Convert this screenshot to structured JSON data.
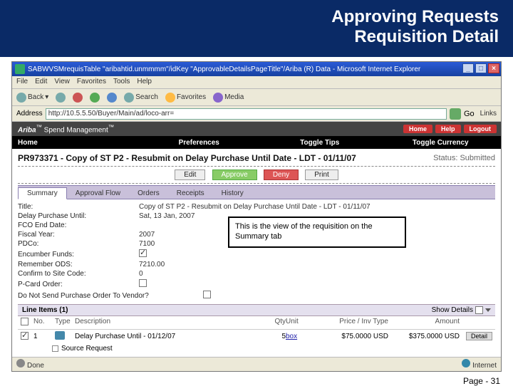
{
  "slide": {
    "title_line1": "Approving Requests",
    "title_line2": "Requisition Detail",
    "footer": "Page - 31"
  },
  "ie": {
    "titlebar": "SABWVSMrequisTable \"aribahtid.unmmmm\"/idKey \"ApprovableDetailsPageTitle\"/Ariba (R) Data - Microsoft Internet Explorer",
    "menus": [
      "File",
      "Edit",
      "View",
      "Favorites",
      "Tools",
      "Help"
    ],
    "toolbar": {
      "back": "Back",
      "search": "Search",
      "favorites": "Favorites",
      "media": "Media"
    },
    "address_label": "Address",
    "address_value": "http://10.5.5.50/Buyer/Main/ad/loco-arr=",
    "go_label": "Go",
    "links_label": "Links",
    "status_left": "Done",
    "status_right": "Internet"
  },
  "ariba": {
    "brand": "Ariba",
    "brand_suffix": " Spend Management",
    "btn_home": "Home",
    "btn_help": "Help",
    "btn_logout": "Logout",
    "subnav": [
      "Home",
      "Preferences",
      "Toggle Tips",
      "Toggle Currency"
    ]
  },
  "req": {
    "title": "PR973371 - Copy of ST P2 - Resubmit on Delay Purchase Until Date - LDT - 01/11/07",
    "status_label": "Status:",
    "status_value": "Submitted",
    "actions": {
      "edit": "Edit",
      "approve": "Approve",
      "deny": "Deny",
      "print": "Print"
    }
  },
  "tabs": [
    "Summary",
    "Approval Flow",
    "Orders",
    "Receipts",
    "History"
  ],
  "form": {
    "rows": [
      {
        "label": "Title:",
        "value": "Copy of ST P2 - Resubmit on Delay Purchase Until Date - LDT - 01/11/07"
      },
      {
        "label": "Delay Purchase Until:",
        "value": "Sat, 13 Jan, 2007"
      },
      {
        "label": "FCO End Date:",
        "value": ""
      },
      {
        "label": "Fiscal Year:",
        "value": "2007"
      },
      {
        "label": "PDCo:",
        "value": "7100"
      },
      {
        "label": "Encumber Funds:",
        "value": "",
        "checkbox": true,
        "checked": true
      },
      {
        "label": "Remember ODS:",
        "value": "7210.00"
      },
      {
        "label": "Confirm to Site Code:",
        "value": "0"
      },
      {
        "label": "P-Card Order:",
        "value": ""
      },
      {
        "label": "Do Not Send Purchase Order To Vendor?",
        "value": ""
      }
    ]
  },
  "callout": "This is the view of the requisition on the Summary tab",
  "line_items": {
    "header_label": "Line Items",
    "count": "(1)",
    "show_details_label": "Show Details",
    "columns": {
      "no": "No.",
      "type": "Type",
      "desc": "Description",
      "qty": "Qty",
      "unit": "Unit",
      "price": "Price / Inv Type",
      "amount": "Amount"
    },
    "row": {
      "no": "1",
      "desc": "Delay Purchase Until - 01/12/07",
      "qty": "5",
      "unit": "box",
      "price": "$75.0000 USD",
      "amount": "$375.0000 USD",
      "detail": "Detail"
    },
    "sub": "Source Request"
  }
}
